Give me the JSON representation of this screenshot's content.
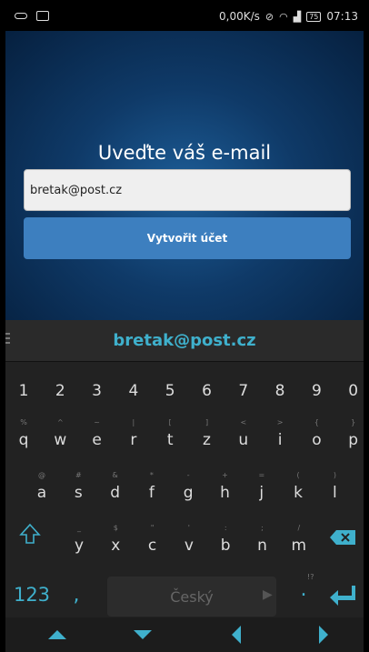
{
  "status": {
    "speed": "0,00K/s",
    "battery": "75",
    "time": "07:13"
  },
  "form": {
    "prompt": "Uveďte váš e-mail",
    "email_value": "bretak@post.cz",
    "submit_label": "Vytvořit účet"
  },
  "keyboard": {
    "suggestion": "bretak@post.cz",
    "numbers": [
      "1",
      "2",
      "3",
      "4",
      "5",
      "6",
      "7",
      "8",
      "9",
      "0"
    ],
    "row1": [
      "q",
      "w",
      "e",
      "r",
      "t",
      "z",
      "u",
      "i",
      "o",
      "p"
    ],
    "row1_hints": [
      "%",
      "^",
      "~",
      "|",
      "[",
      "]",
      "<",
      ">",
      "{",
      "}"
    ],
    "row2": [
      "a",
      "s",
      "d",
      "f",
      "g",
      "h",
      "j",
      "k",
      "l"
    ],
    "row2_hints": [
      "@",
      "#",
      "&",
      "*",
      "-",
      "+",
      "=",
      "(",
      ")"
    ],
    "row3": [
      "y",
      "x",
      "c",
      "v",
      "b",
      "n",
      "m"
    ],
    "row3_hints": [
      "_",
      "$",
      "\"",
      "'",
      ":",
      ";",
      "/"
    ],
    "mode_label": "123",
    "comma": ",",
    "space_label": "Český",
    "period": ".",
    "period_hints": "!?",
    "colors": {
      "accent": "#3fb0cc",
      "key_text": "#dddddd",
      "background": "#222222"
    }
  }
}
